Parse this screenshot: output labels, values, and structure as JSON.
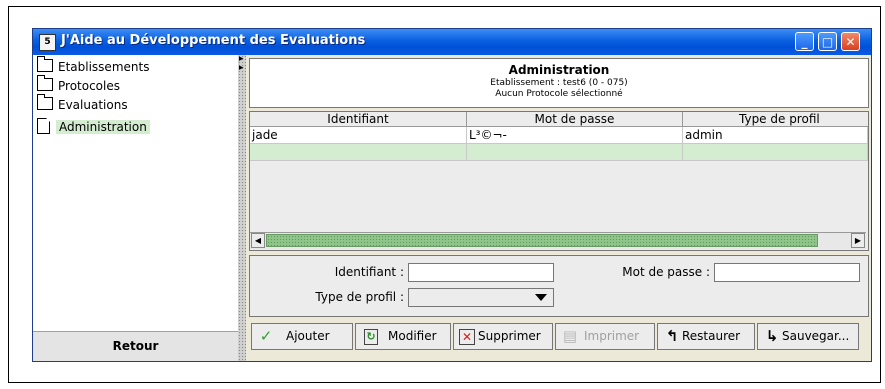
{
  "window": {
    "icon_text": "5",
    "title": "J'Aide au Développement des Evaluations",
    "controls": {
      "minimize": "_",
      "maximize": "□",
      "close": "✕"
    }
  },
  "sidebar": {
    "items": [
      {
        "label": "Etablissements",
        "icon": "folder-icon"
      },
      {
        "label": "Protocoles",
        "icon": "folder-icon"
      },
      {
        "label": "Evaluations",
        "icon": "folder-icon"
      },
      {
        "label": "Administration",
        "icon": "document-icon",
        "selected": true
      }
    ],
    "retour_label": "Retour"
  },
  "header": {
    "title": "Administration",
    "etablissement": "Etablissement : test6 (0 - 075)",
    "protocole": "Aucun Protocole sélectionné"
  },
  "table": {
    "columns": [
      "Identifiant",
      "Mot de passe",
      "Type de profil"
    ],
    "rows": [
      {
        "identifiant": "jade",
        "mot_de_passe": "L³©¬-",
        "type_de_profil": "admin"
      },
      {
        "identifiant": "",
        "mot_de_passe": "",
        "type_de_profil": ""
      }
    ]
  },
  "form": {
    "identifiant_label": "Identifiant :",
    "identifiant_value": "",
    "mot_de_passe_label": "Mot de passe :",
    "mot_de_passe_value": "",
    "type_de_profil_label": "Type de profil :",
    "type_de_profil_value": ""
  },
  "toolbar": {
    "ajouter": "Ajouter",
    "modifier": "Modifier",
    "supprimer": "Supprimer",
    "imprimer": "Imprimer",
    "restaurer": "Restaurer",
    "sauvegarder": "Sauvegar..."
  },
  "colors": {
    "titlebar": "#0a5fe0",
    "selection_green": "#d4ecd0",
    "scroll_thumb": "#8fc48a"
  }
}
